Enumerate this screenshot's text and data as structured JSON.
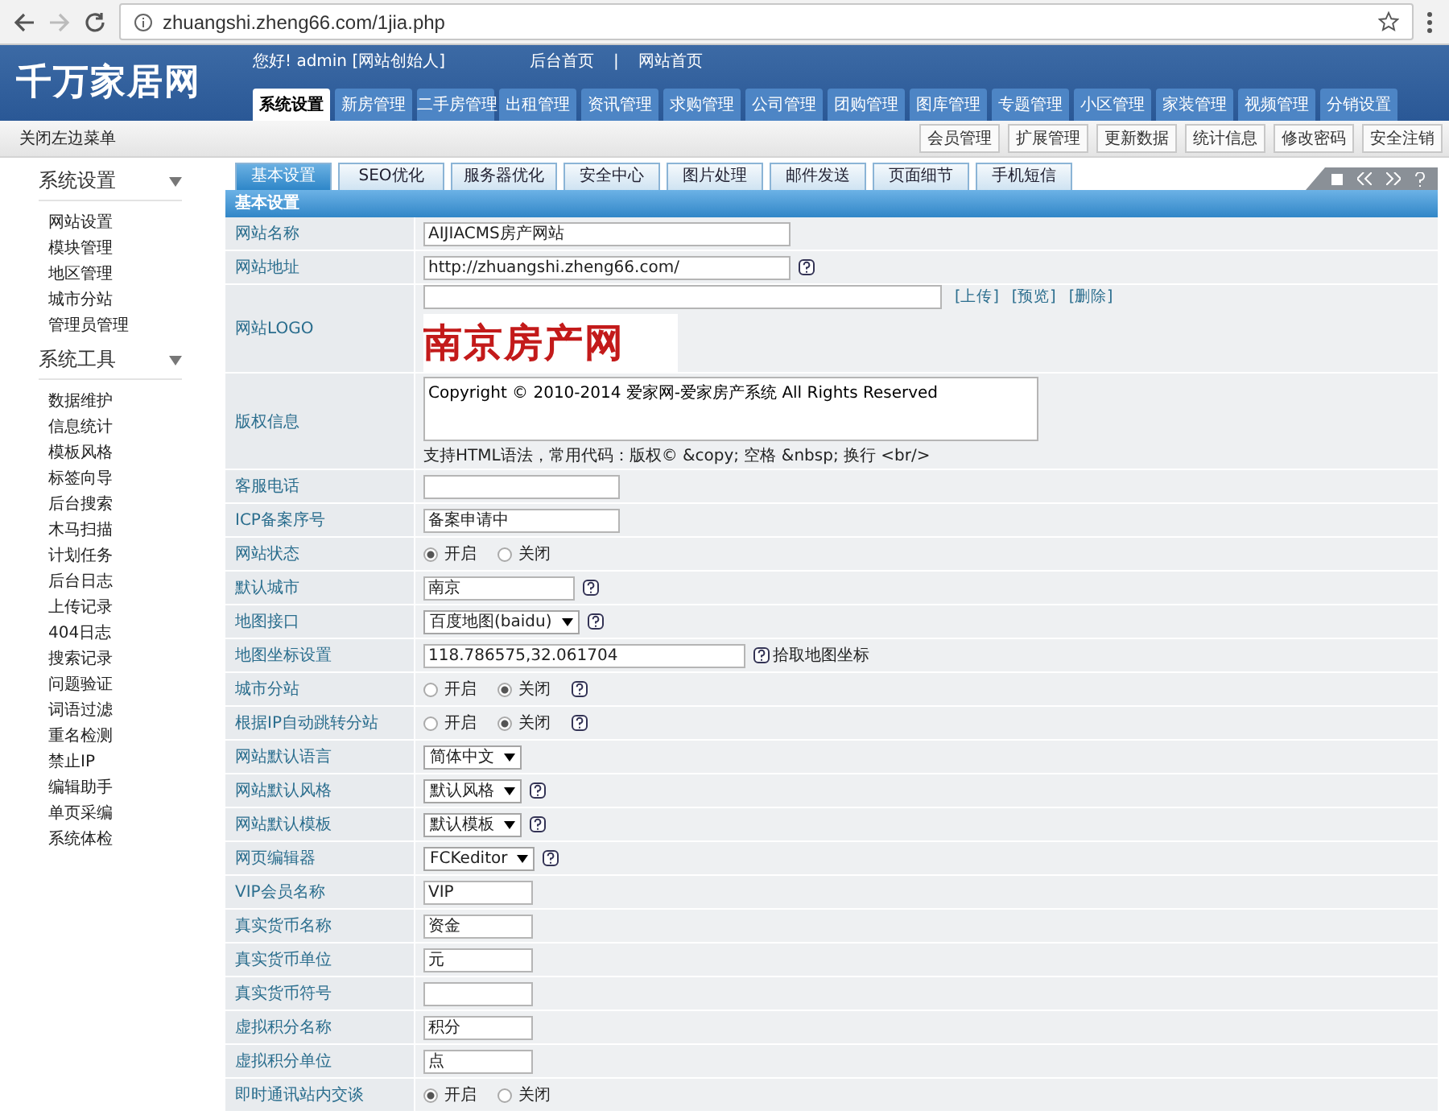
{
  "browser": {
    "url": "zhuangshi.zheng66.com/1jia.php"
  },
  "header": {
    "logo": "千万家居网",
    "greeting": "您好! admin [网站创始人]",
    "links": [
      "后台首页",
      "|",
      "网站首页"
    ],
    "nav": [
      {
        "label": "系统设置",
        "selected": true
      },
      {
        "label": "新房管理",
        "selected": false
      },
      {
        "label": "二手房管理",
        "selected": false
      },
      {
        "label": "出租管理",
        "selected": false
      },
      {
        "label": "资讯管理",
        "selected": false
      },
      {
        "label": "求购管理",
        "selected": false
      },
      {
        "label": "公司管理",
        "selected": false
      },
      {
        "label": "团购管理",
        "selected": false
      },
      {
        "label": "图库管理",
        "selected": false
      },
      {
        "label": "专题管理",
        "selected": false
      },
      {
        "label": "小区管理",
        "selected": false
      },
      {
        "label": "家装管理",
        "selected": false
      },
      {
        "label": "视频管理",
        "selected": false
      },
      {
        "label": "分销设置",
        "selected": false
      }
    ]
  },
  "subbar": {
    "toggle": "关闭左边菜单",
    "buttons": [
      "会员管理",
      "扩展管理",
      "更新数据",
      "统计信息",
      "修改密码",
      "安全注销"
    ]
  },
  "sidebar": [
    {
      "title": "系统设置",
      "expanded": true,
      "items": [
        "网站设置",
        "模块管理",
        "地区管理",
        "城市分站",
        "管理员管理"
      ]
    },
    {
      "title": "系统工具",
      "expanded": true,
      "items": [
        "数据维护",
        "信息统计",
        "模板风格",
        "标签向导",
        "后台搜索",
        "木马扫描",
        "计划任务",
        "后台日志",
        "上传记录",
        "404日志",
        "搜索记录",
        "问题验证",
        "词语过滤",
        "重名检测",
        "禁止IP",
        "编辑助手",
        "单页采编",
        "系统体检"
      ]
    }
  ],
  "tabs": [
    {
      "label": "基本设置",
      "selected": true
    },
    {
      "label": "SEO优化",
      "selected": false
    },
    {
      "label": "服务器优化",
      "selected": false
    },
    {
      "label": "安全中心",
      "selected": false
    },
    {
      "label": "图片处理",
      "selected": false
    },
    {
      "label": "邮件发送",
      "selected": false
    },
    {
      "label": "页面细节",
      "selected": false
    },
    {
      "label": "手机短信",
      "selected": false
    }
  ],
  "section_title": "基本设置",
  "rows": [
    {
      "kind": "text",
      "label": "网站名称",
      "value": "AIJIACMS房产网站",
      "help": false
    },
    {
      "kind": "text",
      "label": "网站地址",
      "value": "http://zhuangshi.zheng66.com/",
      "help": true
    },
    {
      "kind": "logo",
      "label": "网站LOGO",
      "links": [
        "[上传]",
        "[预览]",
        "[删除]"
      ],
      "logo_text": "南京房产网"
    },
    {
      "kind": "textarea",
      "label": "版权信息",
      "value": "Copyright © 2010-2014 爱家网-爱家房产系统 All Rights Reserved",
      "note": "支持HTML语法，常用代码：版权© &copy; 空格 &nbsp; 换行 <br/>"
    },
    {
      "kind": "text",
      "label": "客服电话",
      "help": false
    },
    {
      "kind": "text",
      "label": "ICP备案序号",
      "value": "备案申请中",
      "help": false
    },
    {
      "kind": "radio",
      "label": "网站状态",
      "options": [
        {
          "label": "开启",
          "selected": true
        },
        {
          "label": "关闭",
          "selected": false
        }
      ],
      "help": false
    },
    {
      "kind": "text",
      "label": "默认城市",
      "value": "南京",
      "help": true
    },
    {
      "kind": "select",
      "label": "地图接口",
      "value": "百度地图(baidu)",
      "help": true
    },
    {
      "kind": "text",
      "label": "地图坐标设置",
      "value": "118.786575,32.061704",
      "help": true,
      "link": "拾取地图坐标"
    },
    {
      "kind": "radio",
      "label": "城市分站",
      "options": [
        {
          "label": "开启",
          "selected": false
        },
        {
          "label": "关闭",
          "selected": true
        }
      ],
      "help": true
    },
    {
      "kind": "radio",
      "label": "根据IP自动跳转分站",
      "options": [
        {
          "label": "开启",
          "selected": false
        },
        {
          "label": "关闭",
          "selected": true
        }
      ],
      "help": true
    },
    {
      "kind": "select",
      "label": "网站默认语言",
      "value": "简体中文",
      "help": false
    },
    {
      "kind": "select",
      "label": "网站默认风格",
      "value": "默认风格",
      "help": true
    },
    {
      "kind": "select",
      "label": "网站默认模板",
      "value": "默认模板",
      "help": true
    },
    {
      "kind": "select",
      "label": "网页编辑器",
      "value": "FCKeditor",
      "help": true
    },
    {
      "kind": "text",
      "label": "VIP会员名称",
      "value": "VIP",
      "help": false
    },
    {
      "kind": "text",
      "label": "真实货币名称",
      "value": "资金",
      "help": false
    },
    {
      "kind": "text",
      "label": "真实货币单位",
      "value": "元",
      "help": false
    },
    {
      "kind": "text",
      "label": "真实货币符号",
      "help": false
    },
    {
      "kind": "text",
      "label": "虚拟积分名称",
      "value": "积分",
      "help": false
    },
    {
      "kind": "text",
      "label": "虚拟积分单位",
      "value": "点",
      "help": false
    },
    {
      "kind": "radio",
      "label": "即时通讯站内交谈",
      "options": [
        {
          "label": "开启",
          "selected": true
        },
        {
          "label": "关闭",
          "selected": false
        }
      ],
      "help": false
    }
  ]
}
